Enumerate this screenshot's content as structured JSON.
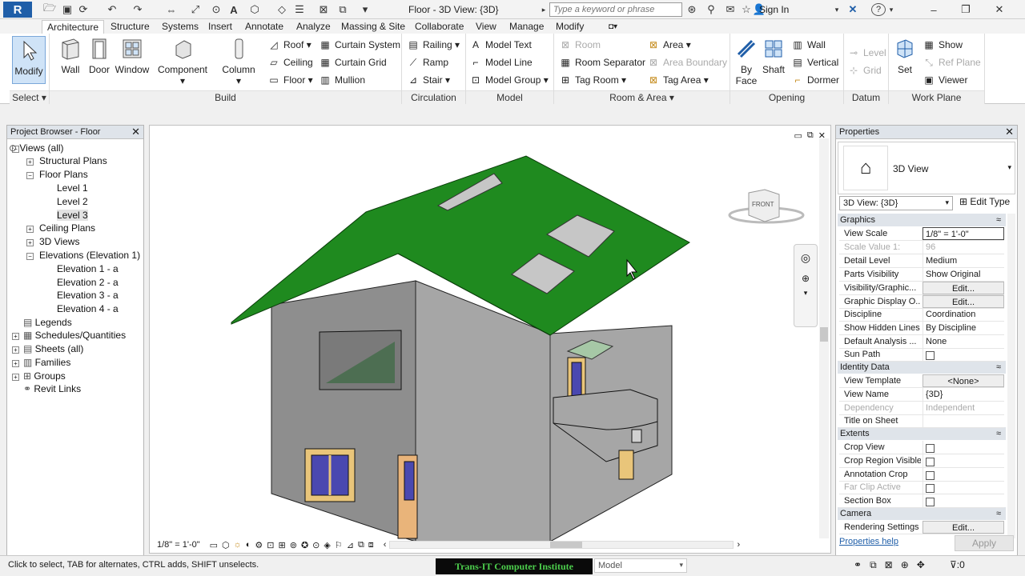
{
  "app": {
    "logo": "R",
    "window_title": "Floor - 3D View: {3D}",
    "search_placeholder": "Type a keyword or phrase",
    "sign_in": "Sign In",
    "help": "?"
  },
  "tabs": [
    "Architecture",
    "Structure",
    "Systems",
    "Insert",
    "Annotate",
    "Analyze",
    "Massing & Site",
    "Collaborate",
    "View",
    "Manage",
    "Modify"
  ],
  "ribbon": {
    "select": {
      "title": "Select",
      "modify": "Modify"
    },
    "build": {
      "title": "Build",
      "wall": "Wall",
      "door": "Door",
      "window": "Window",
      "component": "Component",
      "column": "Column",
      "roof": "Roof",
      "ceiling": "Ceiling",
      "floor": "Floor",
      "curtain_system": "Curtain System",
      "curtain_grid": "Curtain Grid",
      "mullion": "Mullion"
    },
    "circulation": {
      "title": "Circulation",
      "railing": "Railing",
      "ramp": "Ramp",
      "stair": "Stair"
    },
    "model": {
      "title": "Model",
      "model_text": "Model Text",
      "model_line": "Model Line",
      "model_group": "Model Group"
    },
    "room_area": {
      "title": "Room & Area",
      "room": "Room",
      "room_separator": "Room Separator",
      "tag_room": "Tag Room",
      "area": "Area",
      "area_boundary": "Area Boundary",
      "tag_area": "Tag Area"
    },
    "opening": {
      "title": "Opening",
      "by_face_1": "By",
      "by_face_2": "Face",
      "shaft": "Shaft",
      "wall": "Wall",
      "vertical": "Vertical",
      "dormer": "Dormer"
    },
    "datum": {
      "title": "Datum",
      "level": "Level",
      "grid": "Grid"
    },
    "work_plane": {
      "title": "Work Plane",
      "set": "Set",
      "show": "Show",
      "ref_plane": "Ref Plane",
      "viewer": "Viewer"
    }
  },
  "browser": {
    "title": "Project Browser - Floor",
    "items": [
      "Views (all)",
      "Structural Plans",
      "Floor Plans",
      "Level 1",
      "Level 2",
      "Level 3",
      "Ceiling Plans",
      "3D Views",
      "Elevations (Elevation 1)",
      "Elevation 1 - a",
      "Elevation 2 - a",
      "Elevation 3 - a",
      "Elevation 4 - a",
      "Legends",
      "Schedules/Quantities",
      "Sheets (all)",
      "Families",
      "Groups",
      "Revit Links"
    ]
  },
  "viewport": {
    "scale": "1/8\" = 1'-0\"",
    "viewcube_face": "FRONT"
  },
  "properties": {
    "title": "Properties",
    "type_name": "3D View",
    "instance_selector": "3D View: {3D}",
    "edit_type": "Edit Type",
    "sections": {
      "graphics": "Graphics",
      "identity": "Identity Data",
      "extents": "Extents",
      "camera": "Camera"
    },
    "rows": [
      {
        "k": "View Scale",
        "v": "1/8\" = 1'-0\""
      },
      {
        "k": "Scale Value    1:",
        "v": "96"
      },
      {
        "k": "Detail Level",
        "v": "Medium"
      },
      {
        "k": "Parts Visibility",
        "v": "Show Original"
      },
      {
        "k": "Visibility/Graphic...",
        "v": "Edit..."
      },
      {
        "k": "Graphic Display O...",
        "v": "Edit..."
      },
      {
        "k": "Discipline",
        "v": "Coordination"
      },
      {
        "k": "Show Hidden Lines",
        "v": "By Discipline"
      },
      {
        "k": "Default Analysis ...",
        "v": "None"
      },
      {
        "k": "Sun Path",
        "v": ""
      },
      {
        "k": "View Template",
        "v": "<None>"
      },
      {
        "k": "View Name",
        "v": "{3D}"
      },
      {
        "k": "Dependency",
        "v": "Independent"
      },
      {
        "k": "Title on Sheet",
        "v": ""
      },
      {
        "k": "Crop View",
        "v": ""
      },
      {
        "k": "Crop Region Visible",
        "v": ""
      },
      {
        "k": "Annotation Crop",
        "v": ""
      },
      {
        "k": "Far Clip Active",
        "v": ""
      },
      {
        "k": "Section Box",
        "v": ""
      },
      {
        "k": "Rendering Settings",
        "v": "Edit..."
      }
    ],
    "help_link": "Properties help",
    "apply": "Apply"
  },
  "status": {
    "text": "Click to select, TAB for alternates, CTRL adds, SHIFT unselects.",
    "watermark": "Trans-IT Computer Institute",
    "model": "Model",
    "filter_count": ":0"
  },
  "colors": {
    "roof": "#1f8a1f",
    "wall": "#8e8e8e",
    "accent": "#1f5ea8"
  }
}
